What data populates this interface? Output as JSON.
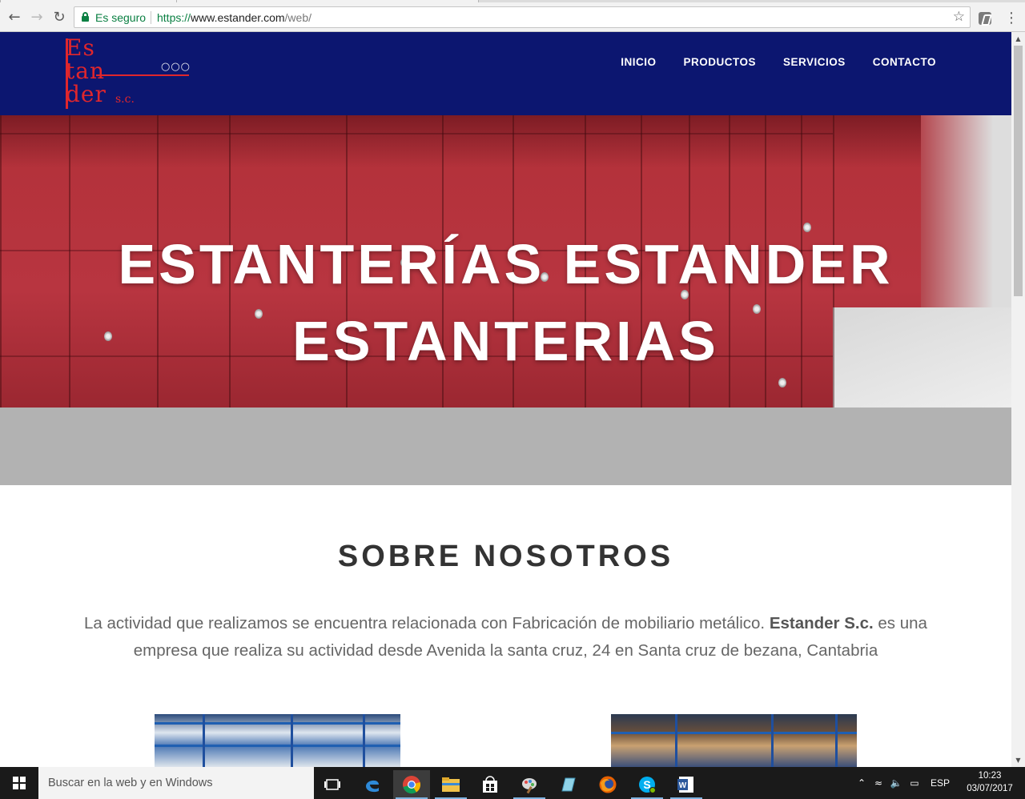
{
  "browser": {
    "secure_label": "Es seguro",
    "url_scheme": "https://",
    "url_host": "www.estander.com",
    "url_path": "/web/"
  },
  "site": {
    "logo": {
      "line1": "Es",
      "line2": "tan",
      "line3": "der",
      "suffix": "s.c."
    },
    "nav": [
      "INICIO",
      "PRODUCTOS",
      "SERVICIOS",
      "CONTACTO"
    ],
    "hero_title_line1": "ESTANTERÍAS ESTANDER",
    "hero_title_line2": "ESTANTERIAS",
    "about": {
      "title": "SOBRE NOSOTROS",
      "text_before": "La actividad que realizamos se encuentra relacionada con Fabricación de mobiliario metálico. ",
      "company": "Estander S.c.",
      "text_after": " es una empresa que realiza su actividad desde Avenida la santa cruz, 24 en Santa cruz de bezana, Cantabria"
    }
  },
  "taskbar": {
    "search_placeholder": "Buscar en la web y en Windows",
    "language": "ESP",
    "time": "10:23",
    "date": "03/07/2017"
  },
  "colors": {
    "header_bg": "#0c1670",
    "logo_red": "#e0262c",
    "hero_red": "#b83540",
    "band_grey": "#b2b2b2"
  }
}
